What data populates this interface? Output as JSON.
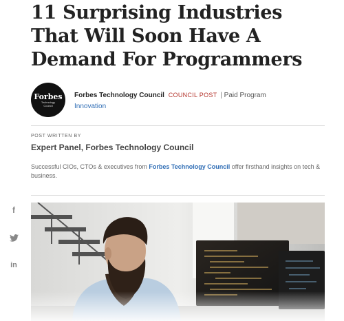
{
  "article": {
    "headline": "11 Surprising Industries That Will Soon Have A Demand For Programmers"
  },
  "author": {
    "avatar_brand": "Forbes",
    "avatar_sub": "Technology Council",
    "name": "Forbes Technology Council",
    "tag": "COUNCIL POST",
    "separator": "|",
    "paid": "Paid Program",
    "channel": "Innovation"
  },
  "post": {
    "written_by_label": "POST WRITTEN BY",
    "expert": "Expert Panel, Forbes Technology Council",
    "desc_before": "Successful CIOs, CTOs & executives from ",
    "desc_link": "Forbes Technology Council",
    "desc_after": " offer firsthand insights on tech & business."
  },
  "social": {
    "facebook": "f",
    "twitter_icon": "twitter-icon",
    "linkedin": "in"
  },
  "colors": {
    "council_tag": "#b3322a",
    "link": "#2f6db5",
    "headline": "#222222"
  }
}
